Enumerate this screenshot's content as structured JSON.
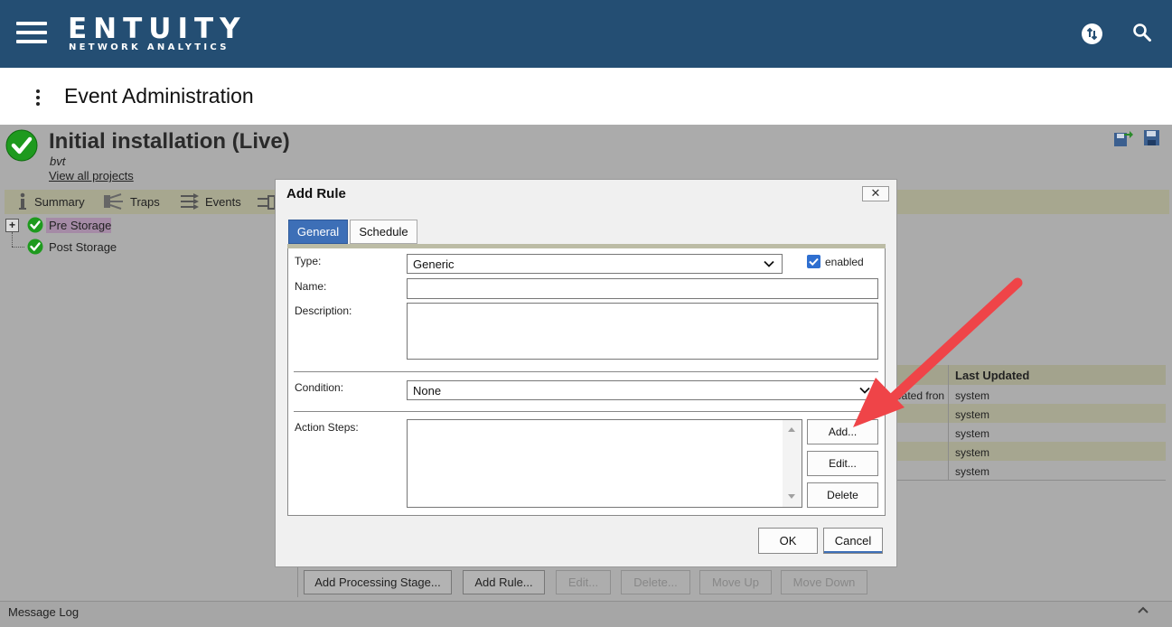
{
  "app": {
    "logo": "ENTUITY",
    "logo_sub": "NETWORK ANALYTICS",
    "page_title": "Event Administration"
  },
  "project": {
    "title": "Initial installation (Live)",
    "subtitle": "bvt",
    "view_all_link": "View all projects"
  },
  "nav": {
    "items": [
      {
        "label": "Summary",
        "icon": "info-icon"
      },
      {
        "label": "Traps",
        "icon": "traps-icon"
      },
      {
        "label": "Events",
        "icon": "events-icon"
      }
    ]
  },
  "tree": {
    "items": [
      {
        "label": "Pre Storage",
        "selected": true
      },
      {
        "label": "Post Storage",
        "selected": false
      }
    ]
  },
  "table": {
    "header_last_updated": "Last Updated",
    "truncated_cell": "eated fron",
    "rows": [
      "system",
      "system",
      "system",
      "system",
      "system"
    ]
  },
  "bottom_buttons": {
    "add_stage": "Add Processing Stage...",
    "add_rule": "Add Rule...",
    "edit": "Edit...",
    "delete": "Delete...",
    "move_up": "Move Up",
    "move_down": "Move Down"
  },
  "message_log": {
    "label": "Message Log"
  },
  "dialog": {
    "title": "Add Rule",
    "close": "✕",
    "tabs": {
      "general": "General",
      "schedule": "Schedule"
    },
    "type_label": "Type:",
    "type_value": "Generic",
    "enabled_label": "enabled",
    "enabled_checked": true,
    "name_label": "Name:",
    "name_value": "",
    "description_label": "Description:",
    "description_value": "",
    "condition_label": "Condition:",
    "condition_value": "None",
    "action_steps_label": "Action Steps:",
    "buttons": {
      "add": "Add...",
      "edit": "Edit...",
      "delete": "Delete",
      "ok": "OK",
      "cancel": "Cancel"
    }
  },
  "colors": {
    "topbar": "#244e73",
    "tab_active": "#3d6fb7",
    "arrow": "#ef4448",
    "check_green": "#1e9a1e"
  }
}
